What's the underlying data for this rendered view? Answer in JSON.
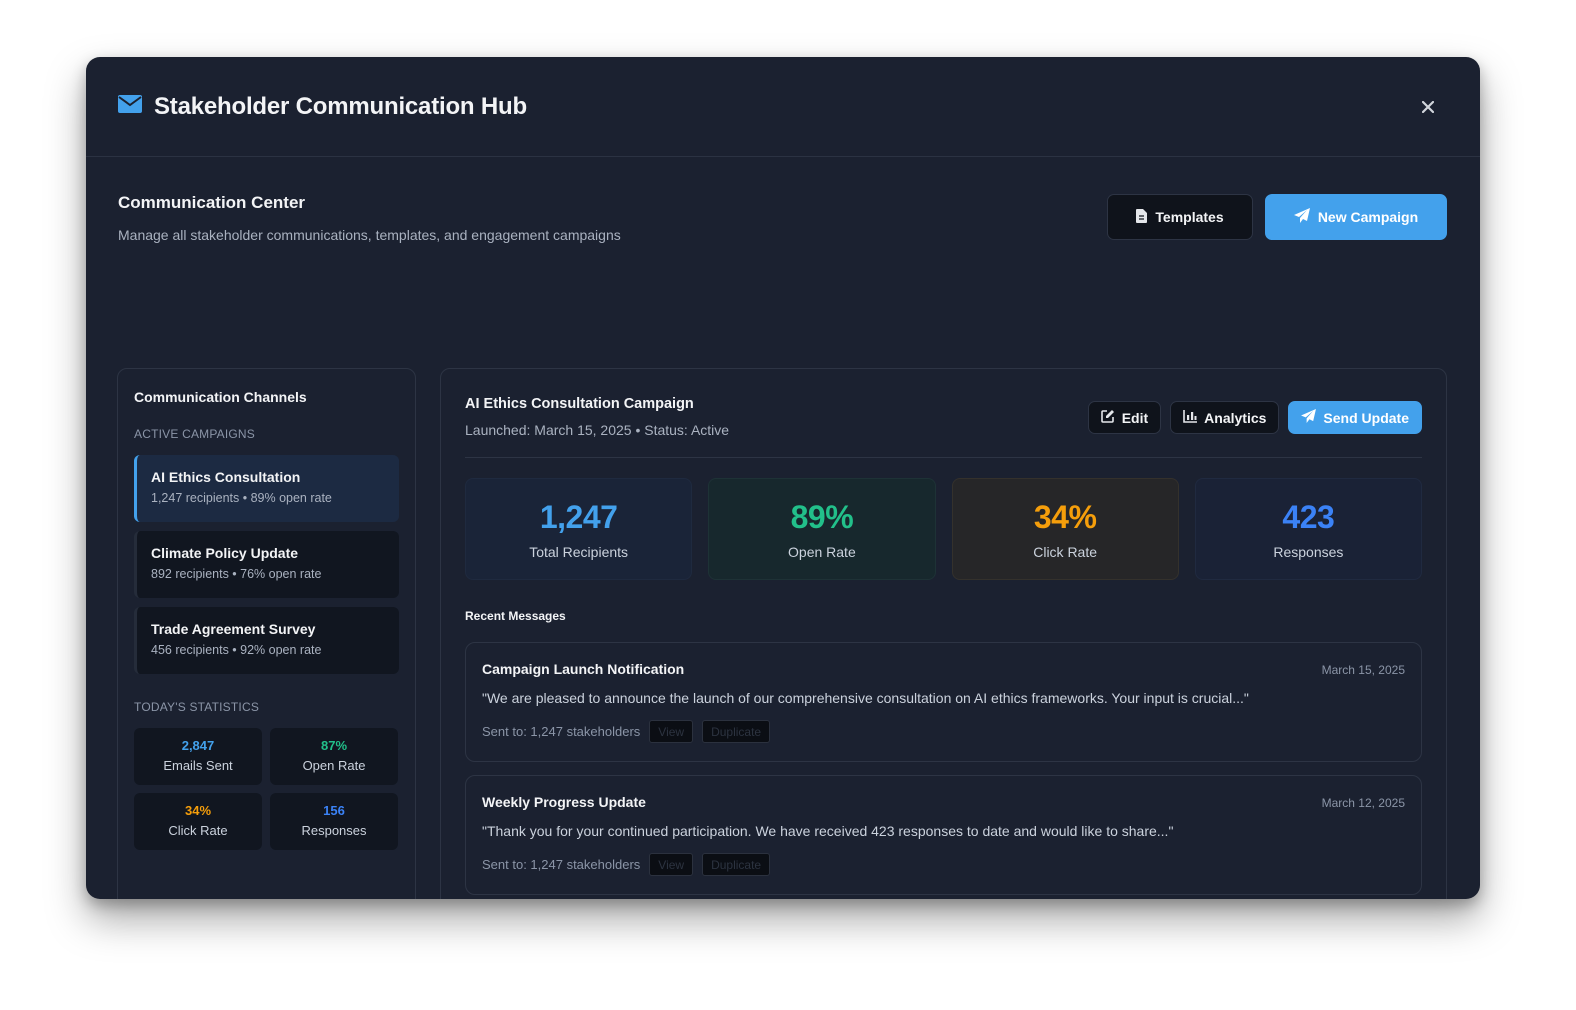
{
  "header": {
    "title": "Stakeholder Communication Hub",
    "icon": "envelope-icon"
  },
  "center": {
    "title": "Communication Center",
    "subtitle": "Manage all stakeholder communications, templates, and engagement campaigns",
    "templates_label": "Templates",
    "new_campaign_label": "New Campaign"
  },
  "sidebar": {
    "title": "Communication Channels",
    "active_label": "Active Campaigns",
    "campaigns": [
      {
        "name": "AI Ethics Consultation",
        "meta": "1,247 recipients • 89% open rate"
      },
      {
        "name": "Climate Policy Update",
        "meta": "892 recipients • 76% open rate"
      },
      {
        "name": "Trade Agreement Survey",
        "meta": "456 recipients • 92% open rate"
      }
    ],
    "stats_label": "Today's Statistics",
    "stats": [
      {
        "value": "2,847",
        "label": "Emails Sent",
        "color": "#43a1ec"
      },
      {
        "value": "87%",
        "label": "Open Rate",
        "color": "#22c08a"
      },
      {
        "value": "34%",
        "label": "Click Rate",
        "color": "#f59e0b"
      },
      {
        "value": "156",
        "label": "Responses",
        "color": "#3b82f6"
      }
    ]
  },
  "campaign": {
    "title": "AI Ethics Consultation Campaign",
    "subtitle": "Launched: March 15, 2025 • Status: Active",
    "edit_label": "Edit",
    "analytics_label": "Analytics",
    "send_label": "Send Update",
    "metrics": [
      {
        "value": "1,247",
        "label": "Total Recipients",
        "color": "#43a1ec",
        "bg": "#1a2438",
        "border": "#1f2a3f"
      },
      {
        "value": "89%",
        "label": "Open Rate",
        "color": "#22c08a",
        "bg": "#17282d",
        "border": "#1e3236"
      },
      {
        "value": "34%",
        "label": "Click Rate",
        "color": "#f59e0b",
        "bg": "#262628",
        "border": "#34312c"
      },
      {
        "value": "423",
        "label": "Responses",
        "color": "#3b82f6",
        "bg": "#1a2236",
        "border": "#202a40"
      }
    ]
  },
  "recent": {
    "title": "Recent Messages",
    "messages": [
      {
        "title": "Campaign Launch Notification",
        "date": "March 15, 2025",
        "body": "\"We are pleased to announce the launch of our comprehensive consultation on AI ethics frameworks. Your input is crucial...\"",
        "sent": "Sent to: 1,247 stakeholders",
        "view_label": "View",
        "duplicate_label": "Duplicate"
      },
      {
        "title": "Weekly Progress Update",
        "date": "March 12, 2025",
        "body": "\"Thank you for your continued participation. We have received 423 responses to date and would like to share...\"",
        "sent": "Sent to: 1,247 stakeholders",
        "view_label": "View",
        "duplicate_label": "Duplicate"
      }
    ]
  }
}
